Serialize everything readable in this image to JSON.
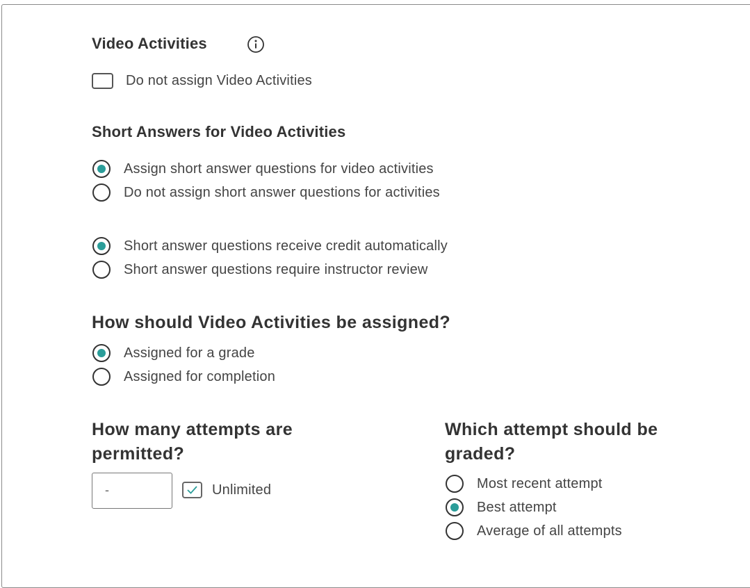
{
  "video_activities": {
    "heading": "Video Activities",
    "info_icon": "info-icon",
    "do_not_assign_label": "Do not assign Video Activities",
    "do_not_assign_checked": false
  },
  "short_answers": {
    "heading": "Short Answers for Video Activities",
    "assign_options": [
      {
        "label": "Assign short answer questions for video activities",
        "selected": true
      },
      {
        "label": "Do not assign short answer questions for activities",
        "selected": false
      }
    ],
    "credit_options": [
      {
        "label": "Short answer questions receive credit automatically",
        "selected": true
      },
      {
        "label": "Short answer questions require instructor review",
        "selected": false
      }
    ]
  },
  "assignment": {
    "heading": "How should Video Activities be assigned?",
    "options": [
      {
        "label": "Assigned for a grade",
        "selected": true
      },
      {
        "label": "Assigned for completion",
        "selected": false
      }
    ]
  },
  "attempts": {
    "heading_line1": "How many attempts are",
    "heading_line2": "permitted?",
    "input_value": "-",
    "unlimited_label": "Unlimited",
    "unlimited_checked": true
  },
  "graded_attempt": {
    "heading_line1": "Which attempt should be",
    "heading_line2": "graded?",
    "options": [
      {
        "label": "Most recent attempt",
        "selected": false
      },
      {
        "label": "Best attempt",
        "selected": true
      },
      {
        "label": "Average of all attempts",
        "selected": false
      }
    ]
  },
  "colors": {
    "accent": "#2a9d99",
    "text": "#333333"
  }
}
